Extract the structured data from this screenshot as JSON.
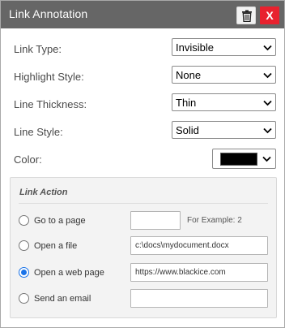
{
  "dialog": {
    "title": "Link Annotation",
    "delete_icon": "trash-icon",
    "close_label": "X"
  },
  "fields": {
    "link_type": {
      "label": "Link Type:",
      "value": "Invisible"
    },
    "highlight_style": {
      "label": "Highlight Style:",
      "value": "None"
    },
    "line_thickness": {
      "label": "Line Thickness:",
      "value": "Thin"
    },
    "line_style": {
      "label": "Line Style:",
      "value": "Solid"
    },
    "color": {
      "label": "Color:",
      "value": "#000000"
    }
  },
  "link_action": {
    "title": "Link Action",
    "selected": "web_page",
    "options": [
      {
        "id": "page",
        "label": "Go to a page",
        "value": "",
        "hint": "For Example: 2",
        "checked": false
      },
      {
        "id": "file",
        "label": "Open a file",
        "value": "c:\\docs\\mydocument.docx",
        "checked": false
      },
      {
        "id": "web_page",
        "label": "Open a web page",
        "value": "https://www.blackice.com",
        "checked": true
      },
      {
        "id": "email",
        "label": "Send an email",
        "value": "",
        "checked": false
      }
    ]
  },
  "colors": {
    "titlebar": "#666666",
    "close_button": "#e8212e",
    "radio_selected": "#1a73e8",
    "group_background": "#f3f3f3"
  }
}
